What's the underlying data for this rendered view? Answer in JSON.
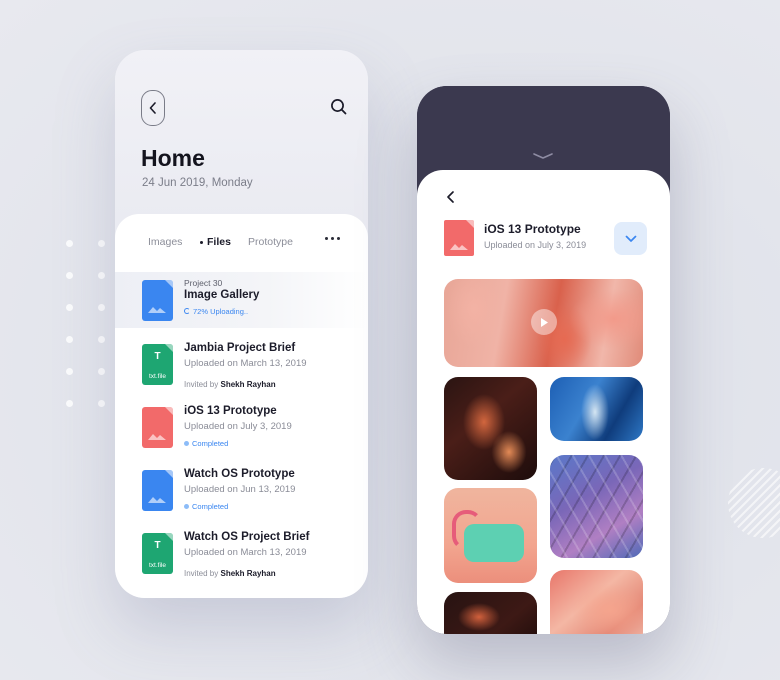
{
  "left_screen": {
    "title": "Home",
    "date": "24 Jun 2019, Monday",
    "tabs": [
      "Images",
      "Files",
      "Prototype"
    ],
    "active_tab": "Files",
    "files": [
      {
        "kicker": "Project 30",
        "title": "Image Gallery",
        "status": "72% Uploading..",
        "icon_color": "#3a86f0",
        "type": "image"
      },
      {
        "title": "Jambia Project Brief",
        "subtitle": "Uploaded on March 13, 2019",
        "invited_label": "Invited by",
        "invited_name": "Shekh Rayhan",
        "icon_color": "#1ea672",
        "type": "txt",
        "icon_letter": "T",
        "icon_label": "txt.file"
      },
      {
        "title": "iOS 13 Prototype",
        "subtitle": "Uploaded on July 3, 2019",
        "status": "Completed",
        "icon_color": "#f26a6a",
        "type": "image"
      },
      {
        "title": "Watch OS Prototype",
        "subtitle": "Uploaded on Jun 13, 2019",
        "status": "Completed",
        "icon_color": "#3a86f0",
        "type": "image"
      },
      {
        "title": "Watch OS Project Brief",
        "subtitle": "Uploaded on March 13, 2019",
        "invited_label": "Invited by",
        "invited_name": "Shekh Rayhan",
        "icon_color": "#1ea672",
        "type": "txt",
        "icon_letter": "T",
        "icon_label": "txt.file"
      }
    ]
  },
  "right_screen": {
    "file_title": "iOS 13 Prototype",
    "file_subtitle": "Uploaded on July 3, 2019",
    "icon_color": "#f26a6a",
    "download_icon": "chevron-down-icon",
    "gallery": [
      "flamingo-video",
      "abstract-orange",
      "blue-ice",
      "geometric-dome",
      "retro-telephone",
      "abstract-orange-2",
      "flamingo-feathers"
    ]
  },
  "colors": {
    "accent": "#3a86f0",
    "dark_header": "#3b394f",
    "background": "#e3e5ec"
  }
}
